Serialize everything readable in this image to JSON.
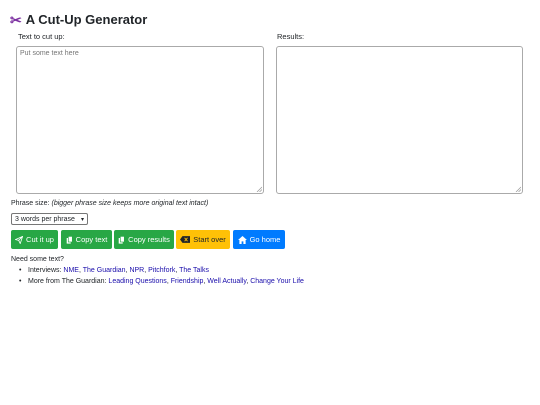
{
  "page": {
    "title": "A Cut-Up Generator",
    "title_icon": "scissors-icon"
  },
  "input": {
    "label": "Text to cut up:",
    "placeholder": "Put some text here",
    "value": ""
  },
  "output": {
    "label": "Results:",
    "value": ""
  },
  "phrase": {
    "label": "Phrase size:",
    "hint": "(bigger phrase size keeps more original text intact)",
    "selected": "3 words per phrase"
  },
  "buttons": {
    "cut": "Cut it up",
    "copy_text": "Copy text",
    "copy_results": "Copy results",
    "start_over": "Start over",
    "go_home": "Go home"
  },
  "colors": {
    "success": "#28a745",
    "warning": "#ffc107",
    "primary": "#007bff",
    "title_icon": "#7b2fa0",
    "link": "#1a0dab"
  },
  "need": {
    "heading": "Need some text?",
    "interviews_prefix": "Interviews:",
    "interviews": [
      "NME",
      "The Guardian",
      "NPR",
      "Pitchfork",
      "The Talks"
    ],
    "guardian_prefix": "More from The Guardian:",
    "guardian": [
      "Leading Questions",
      "Friendship",
      "Well Actually",
      "Change Your Life"
    ]
  }
}
